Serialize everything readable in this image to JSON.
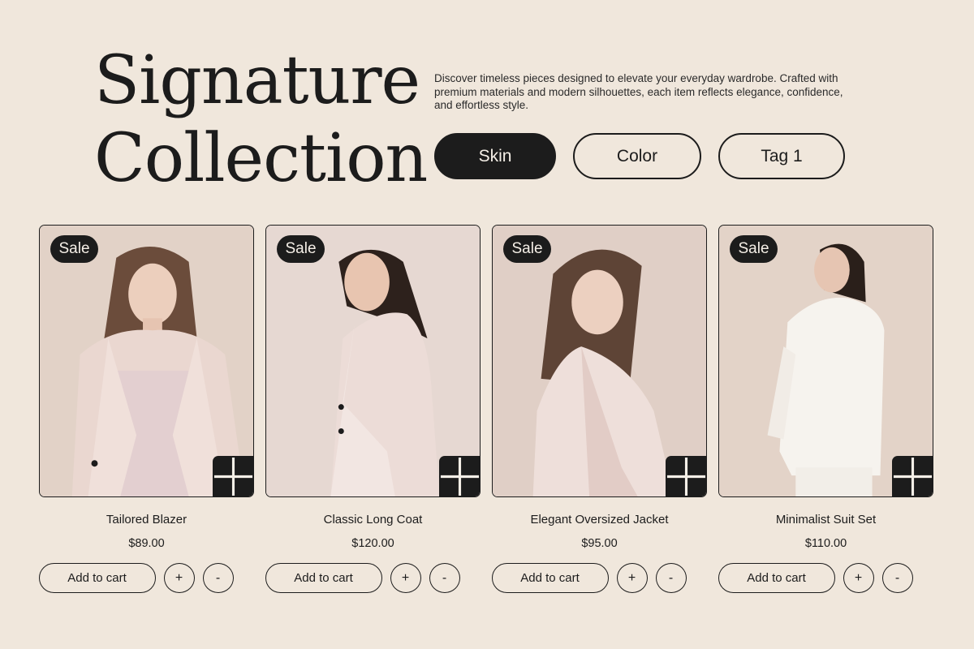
{
  "header": {
    "title_line1": "Signature",
    "title_line2": "Collection",
    "description": "Discover timeless pieces designed to elevate your everyday wardrobe. Crafted with premium materials and modern silhouettes, each item reflects elegance, confidence, and effortless style."
  },
  "filters": [
    {
      "label": "Skin",
      "active": true
    },
    {
      "label": "Color",
      "active": false
    },
    {
      "label": "Tag 1",
      "active": false
    }
  ],
  "products": [
    {
      "badge": "Sale",
      "name": "Tailored Blazer",
      "price": "$89.00",
      "add_label": "Add to cart",
      "inc_label": "+",
      "dec_label": "-"
    },
    {
      "badge": "Sale",
      "name": "Classic Long Coat",
      "price": "$120.00",
      "add_label": "Add to cart",
      "inc_label": "+",
      "dec_label": "-"
    },
    {
      "badge": "Sale",
      "name": "Elegant Oversized Jacket",
      "price": "$95.00",
      "add_label": "Add to cart",
      "inc_label": "+",
      "dec_label": "-"
    },
    {
      "badge": "Sale",
      "name": "Minimalist Suit Set",
      "price": "$110.00",
      "add_label": "Add to cart",
      "inc_label": "+",
      "dec_label": "-"
    }
  ],
  "icons": {
    "quick_add": "plus-icon"
  },
  "colors": {
    "background": "#f0e7dc",
    "ink": "#1c1c1c",
    "chip_active_text": "#f5efe7"
  }
}
